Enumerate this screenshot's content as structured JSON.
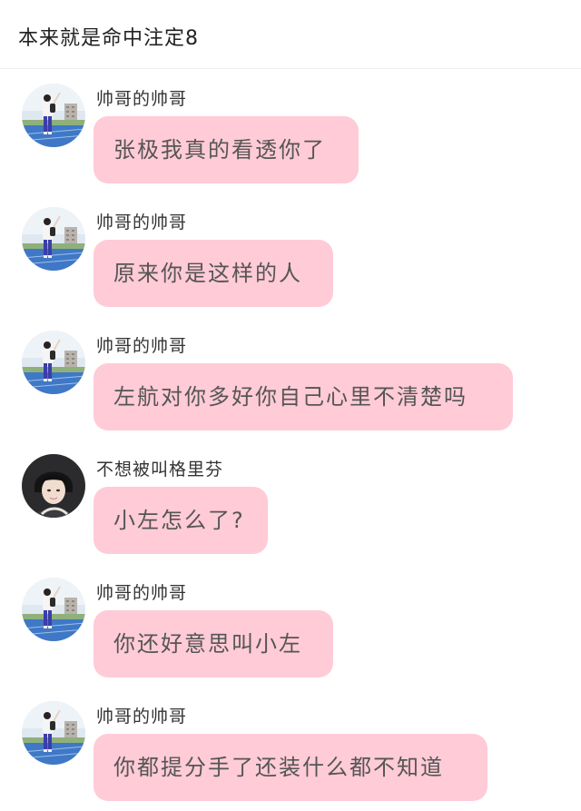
{
  "chat": {
    "title": "本来就是命中注定8"
  },
  "messages": [
    {
      "sender": "帅哥的帅哥",
      "text": "张极我真的看透你了",
      "avatar": "runner-photo-avatar"
    },
    {
      "sender": "帅哥的帅哥",
      "text": "原来你是这样的人",
      "avatar": "runner-photo-avatar"
    },
    {
      "sender": "帅哥的帅哥",
      "text": "左航对你多好你自己心里不清楚吗",
      "avatar": "runner-photo-avatar"
    },
    {
      "sender": "不想被叫格里芬",
      "text": "小左怎么了?",
      "avatar": "portrait-photo-avatar"
    },
    {
      "sender": "帅哥的帅哥",
      "text": "你还好意思叫小左",
      "avatar": "runner-photo-avatar"
    },
    {
      "sender": "帅哥的帅哥",
      "text": "你都提分手了还装什么都不知道",
      "avatar": "runner-photo-avatar"
    }
  ],
  "colors": {
    "bubble": "#ffcbd7",
    "bubble_text": "#555555",
    "sender_text": "#333333",
    "background": "#ffffff"
  }
}
